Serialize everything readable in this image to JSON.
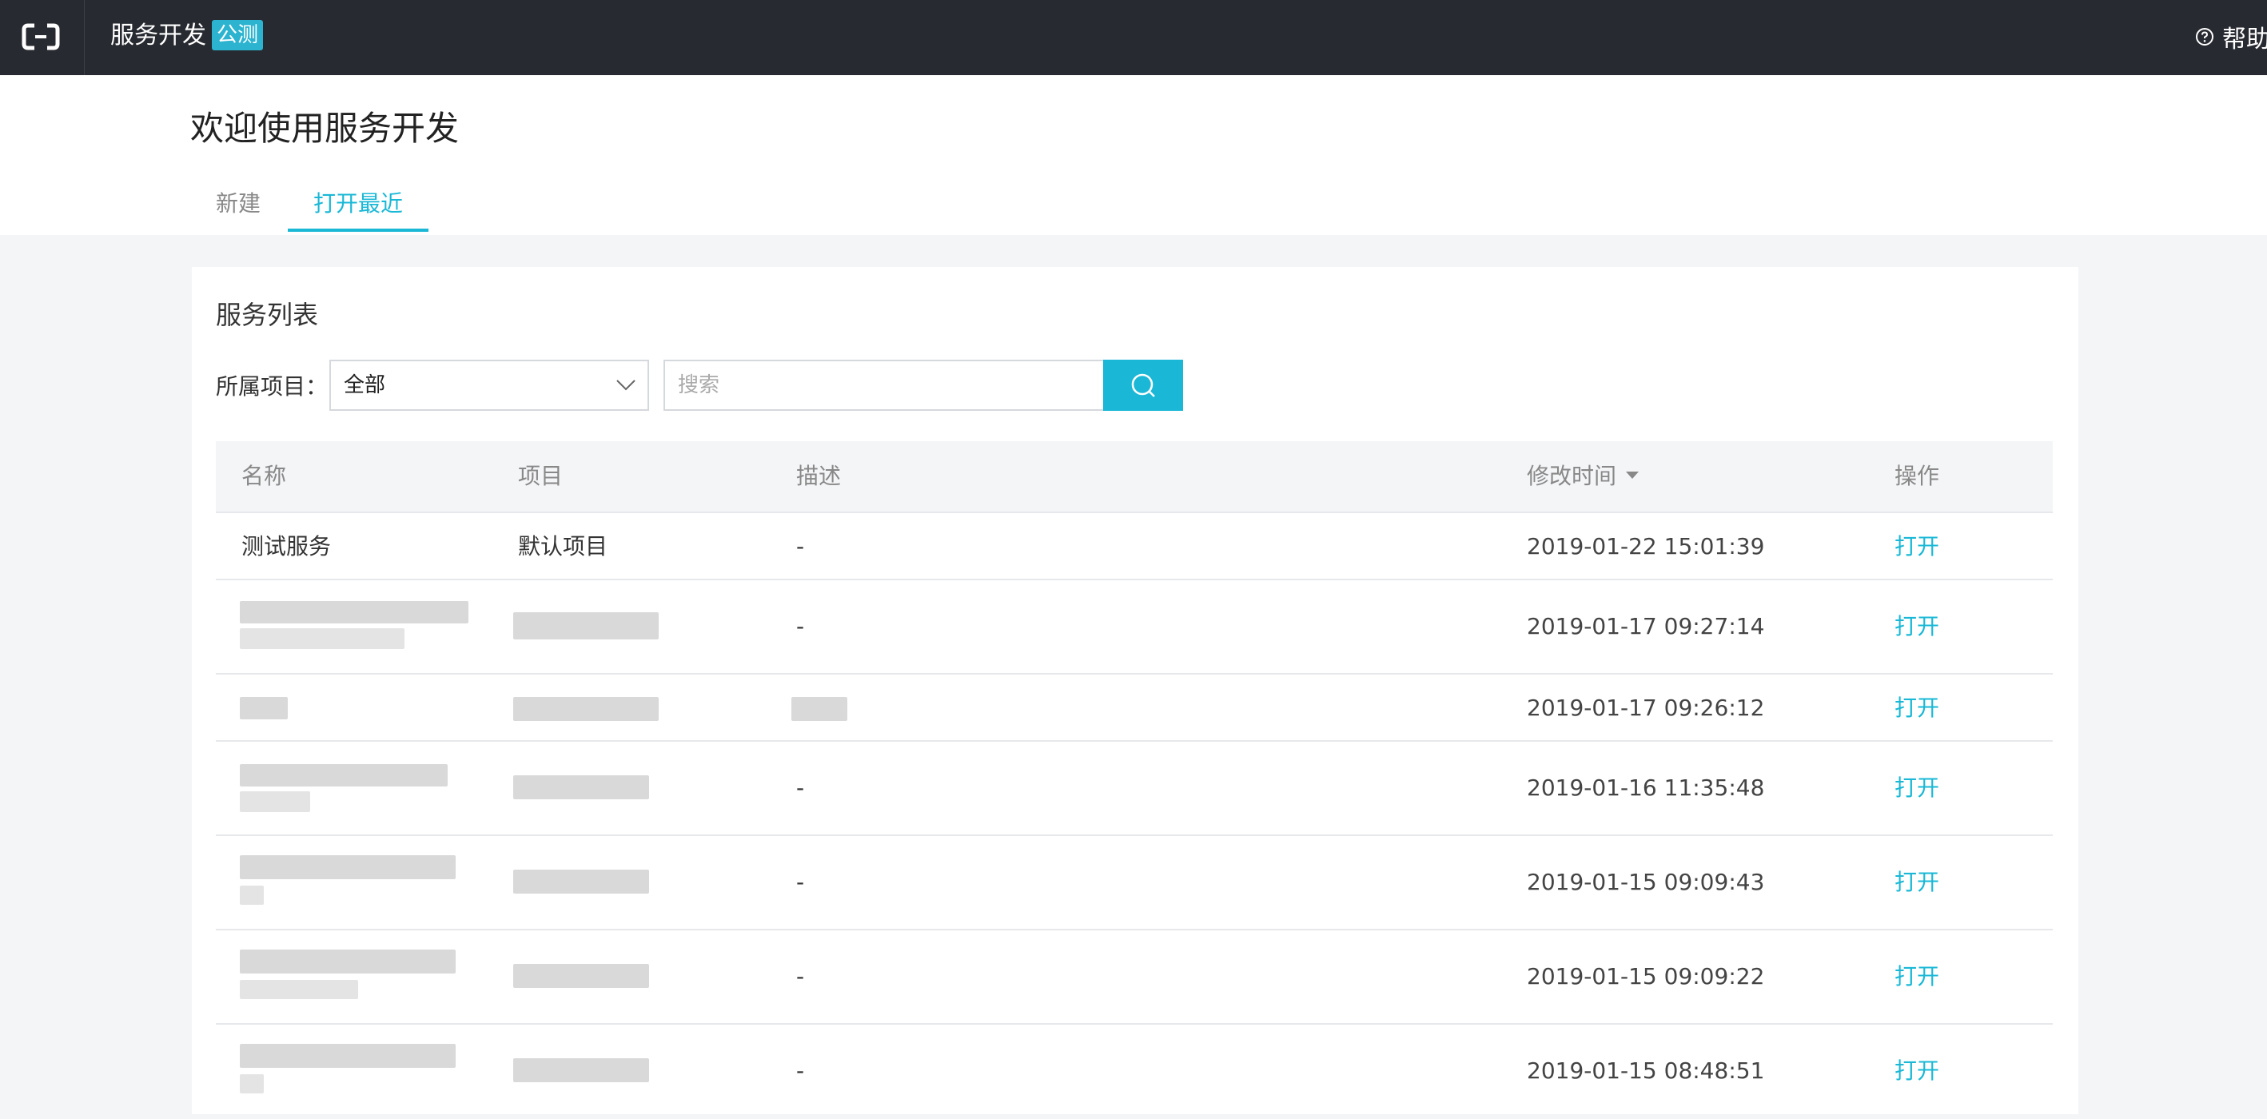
{
  "topbar": {
    "app_title": "服务开发",
    "badge": "公测",
    "help_label": "帮助",
    "logo_icon": "alibaba-cloud-logo-icon",
    "help_icon": "question-circle-icon",
    "background": "#272a30"
  },
  "header": {
    "title": "欢迎使用服务开发",
    "tabs": [
      {
        "label": "新建",
        "active": false
      },
      {
        "label": "打开最近",
        "active": true
      }
    ]
  },
  "service_list": {
    "title": "服务列表",
    "filter_label": "所属项目：",
    "project_select": {
      "value": "全部"
    },
    "search": {
      "placeholder": "搜索",
      "value": ""
    },
    "search_icon": "search-icon",
    "columns": {
      "name": "名称",
      "project": "项目",
      "description": "描述",
      "modified": "修改时间",
      "action": "操作"
    },
    "sort_icon": "caret-down-icon",
    "rows": [
      {
        "name": "测试服务",
        "project": "默认项目",
        "description": "-",
        "modified": "2019-01-22 15:01:39",
        "action": "打开"
      },
      {
        "name": "",
        "project": "",
        "description": "-",
        "modified": "2019-01-17 09:27:14",
        "action": "打开"
      },
      {
        "name": "",
        "project": "",
        "description": "",
        "modified": "2019-01-17 09:26:12",
        "action": "打开"
      },
      {
        "name": "",
        "project": "",
        "description": "-",
        "modified": "2019-01-16 11:35:48",
        "action": "打开"
      },
      {
        "name": "",
        "project": "",
        "description": "-",
        "modified": "2019-01-15 09:09:43",
        "action": "打开"
      },
      {
        "name": "",
        "project": "",
        "description": "-",
        "modified": "2019-01-15 09:09:22",
        "action": "打开"
      },
      {
        "name": "",
        "project": "",
        "description": "-",
        "modified": "2019-01-15 08:48:51",
        "action": "打开"
      }
    ]
  },
  "colors": {
    "accent": "#1ab8d6",
    "page_background": "#f4f5f7"
  }
}
